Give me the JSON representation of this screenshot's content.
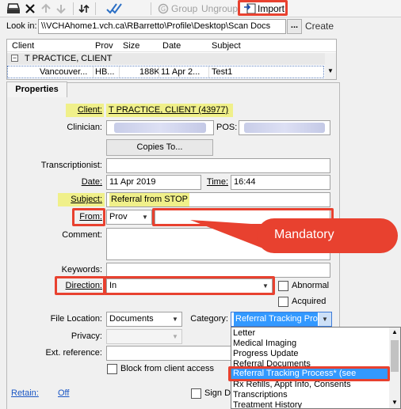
{
  "toolbar": {
    "group_label": "Group",
    "ungroup_label": "Ungroup",
    "import_label": "Import"
  },
  "lookin": {
    "label": "Look in:",
    "path": "\\\\VCHAhome1.vch.ca\\RBarretto\\Profile\\Desktop\\Scan Docs",
    "browse_label": "...",
    "create_label": "Create"
  },
  "list": {
    "columns": [
      "Client",
      "Prov",
      "Size",
      "Date",
      "Subject"
    ],
    "group_row": "T PRACTICE, CLIENT",
    "rows": [
      {
        "client": "Vancouver...",
        "prov": "HB...",
        "size": "188K",
        "date": "11 Apr 2...",
        "subject": "Test1"
      }
    ]
  },
  "tab": {
    "label": "Properties"
  },
  "form": {
    "client_label": "Client:",
    "client_value": "T PRACTICE, CLIENT (43977)",
    "clinician_label": "Clinician:",
    "pos_label": "POS:",
    "copies_to_label": "Copies To...",
    "transcriptionist_label": "Transcriptionist:",
    "date_label": "Date:",
    "date_value": "11 Apr 2019",
    "time_label": "Time:",
    "time_value": "16:44",
    "subject_label": "Subject:",
    "subject_value": "Referral from STOP",
    "from_label": "From:",
    "from_value": "Prov",
    "comment_label": "Comment:",
    "keywords_label": "Keywords:",
    "direction_label": "Direction:",
    "direction_value": "In",
    "abnormal_label": "Abnormal",
    "acquired_label": "Acquired",
    "file_location_label": "File Location:",
    "file_location_value": "Documents",
    "category_label": "Category:",
    "category_value": "Referral Tracking Proc",
    "privacy_label": "Privacy:",
    "ext_reference_label": "Ext. reference:",
    "block_label": "Block from client access",
    "retain_label": "Retain:",
    "retain_value": "Off",
    "sign_label": "Sign Do"
  },
  "callout": {
    "text": "Mandatory"
  },
  "category_options": [
    "Letter",
    "Medical Imaging",
    "Progress Update",
    "Referral Documents",
    "Referral Tracking Process* (see helpfile)",
    "Rx Refills, Appt Info, Consents",
    "Transcriptions",
    "Treatment History"
  ],
  "colors": {
    "annotation_red": "#e8412f",
    "highlight_yellow": "#f0f08a",
    "selected_blue": "#3399ff"
  }
}
